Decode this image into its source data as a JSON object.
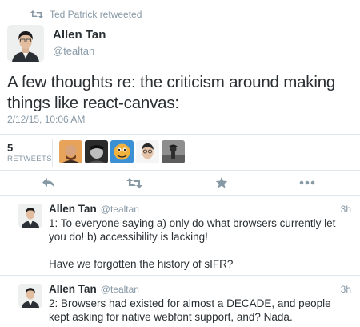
{
  "retweet_context": {
    "text": "Ted Patrick retweeted",
    "icon": "retweet-icon"
  },
  "main_tweet": {
    "author_name": "Allen Tan",
    "author_handle": "@tealtan",
    "text": "A few thoughts re: the criticism around making things like react-canvas:",
    "timestamp": "2/12/15, 10:06 AM",
    "retweet_count": "5",
    "retweet_label": "RETWEETS",
    "retweeter_avatars": [
      "retweeter-avatar-1",
      "retweeter-avatar-2",
      "retweeter-avatar-3",
      "retweeter-avatar-4",
      "retweeter-avatar-5"
    ]
  },
  "actions": [
    {
      "name": "reply",
      "icon": "reply-icon"
    },
    {
      "name": "retweet",
      "icon": "retweet-icon"
    },
    {
      "name": "favorite",
      "icon": "star-icon"
    },
    {
      "name": "more",
      "icon": "more-icon"
    }
  ],
  "replies": [
    {
      "author_name": "Allen Tan",
      "author_handle": "@tealtan",
      "time": "3h",
      "text": "1: To everyone saying a) only do what browsers currently let you do! b) accessibility is lacking!\n\nHave we forgotten the history of sIFR?"
    },
    {
      "author_name": "Allen Tan",
      "author_handle": "@tealtan",
      "time": "3h",
      "text": "2: Browsers had existed for almost a DECADE, and people kept asking for native webfont support, and? Nada."
    }
  ],
  "colors": {
    "text": "#292f33",
    "muted": "#8899a6",
    "divider": "#e1e8ed",
    "icon": "#8899a6"
  }
}
